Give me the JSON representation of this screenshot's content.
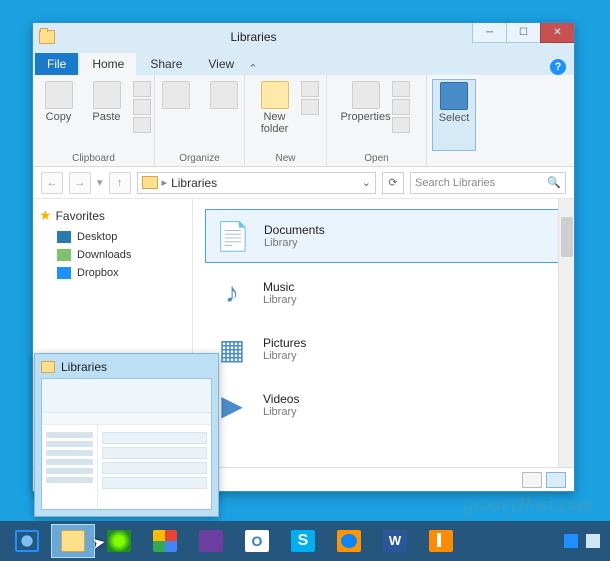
{
  "window": {
    "title": "Libraries",
    "tabs": {
      "file": "File",
      "home": "Home",
      "share": "Share",
      "view": "View"
    },
    "ribbon": {
      "clipboard": {
        "copy": "Copy",
        "paste": "Paste",
        "label": "Clipboard"
      },
      "organize": {
        "label": "Organize"
      },
      "new": {
        "newfolder": "New\nfolder",
        "label": "New"
      },
      "open": {
        "properties": "Properties",
        "label": "Open"
      },
      "select": {
        "select": "Select",
        "label": ""
      }
    },
    "nav": {
      "path": "Libraries"
    },
    "search": {
      "placeholder": "Search Libraries"
    },
    "tree": {
      "favorites": "Favorites",
      "items": [
        {
          "label": "Desktop"
        },
        {
          "label": "Downloads"
        },
        {
          "label": "Dropbox"
        }
      ]
    },
    "libraries": [
      {
        "name": "Documents",
        "sub": "Library",
        "icon": "📄",
        "selected": true
      },
      {
        "name": "Music",
        "sub": "Library",
        "icon": "♪",
        "selected": false
      },
      {
        "name": "Pictures",
        "sub": "Library",
        "icon": "▦",
        "selected": false
      },
      {
        "name": "Videos",
        "sub": "Library",
        "icon": "▶",
        "selected": false
      }
    ]
  },
  "thumbnail": {
    "title": "Libraries"
  },
  "watermark": "groovyPost.com",
  "taskbar": {
    "apps": [
      {
        "name": "internet-explorer",
        "cls": "ie"
      },
      {
        "name": "file-explorer",
        "cls": "ic1",
        "active": true
      },
      {
        "name": "app-green",
        "cls": "ic2"
      },
      {
        "name": "chrome",
        "cls": "ic3"
      },
      {
        "name": "app-purple",
        "cls": "ic4"
      },
      {
        "name": "outlook",
        "cls": "ic5",
        "text": "O"
      },
      {
        "name": "skype",
        "cls": "ic6",
        "text": "S"
      },
      {
        "name": "firefox",
        "cls": "ic7"
      },
      {
        "name": "word",
        "cls": "ic8",
        "text": "W"
      },
      {
        "name": "vlc",
        "cls": "ic9"
      }
    ]
  }
}
